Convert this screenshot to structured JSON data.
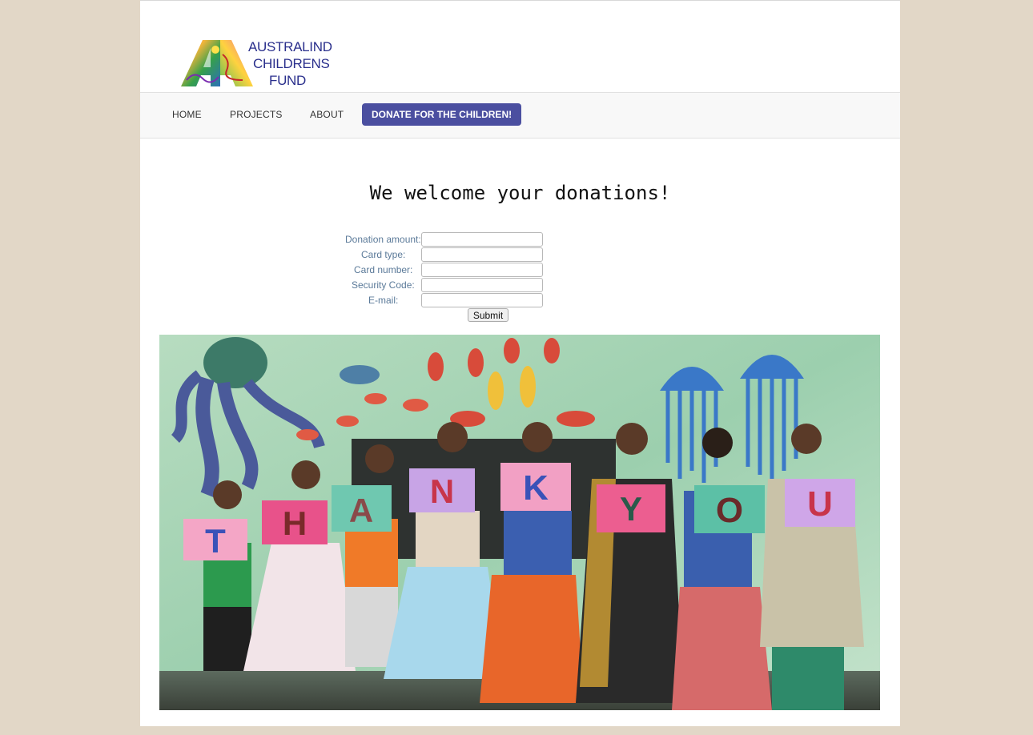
{
  "logo": {
    "line1": "AUSTRALIND",
    "line2": "CHILDRENS",
    "line3": "FUND",
    "text_color": "#2a2f8c"
  },
  "nav": {
    "items": [
      {
        "label": "HOME"
      },
      {
        "label": "PROJECTS"
      },
      {
        "label": "ABOUT"
      }
    ],
    "donate_label": "DONATE FOR THE CHILDREN!",
    "donate_color": "#4b4fa0"
  },
  "main": {
    "heading": "We welcome your donations!"
  },
  "form": {
    "fields": [
      {
        "label": "Donation amount:",
        "value": ""
      },
      {
        "label": "Card type:",
        "value": ""
      },
      {
        "label": "Card number:",
        "value": ""
      },
      {
        "label": "Security Code:",
        "value": ""
      },
      {
        "label": "E-mail:",
        "value": ""
      }
    ],
    "submit_label": "Submit",
    "label_color": "#5b7a99"
  },
  "photo": {
    "letters": [
      "T",
      "H",
      "A",
      "N",
      "K",
      "Y",
      "O",
      "U"
    ]
  },
  "colors": {
    "background": "#e2d7c7",
    "page": "#ffffff"
  }
}
